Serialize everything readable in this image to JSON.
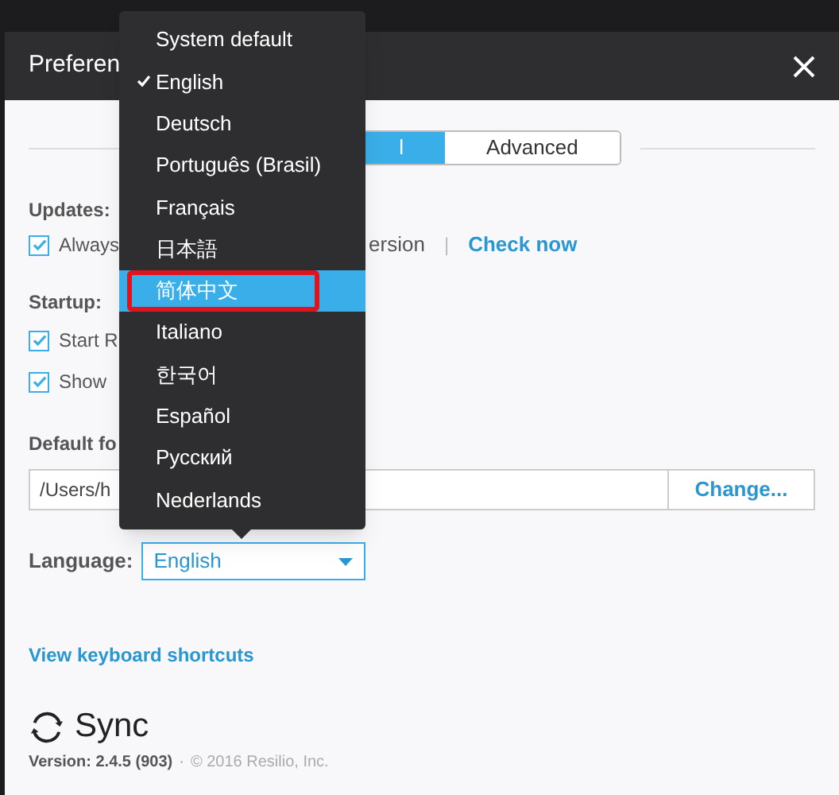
{
  "window": {
    "title": "Preferen"
  },
  "tabs": [
    {
      "label": "l",
      "selected": true
    },
    {
      "label": "Advanced",
      "selected": false
    }
  ],
  "updates": {
    "heading": "Updates:",
    "option": {
      "label": "Always",
      "checked": true
    },
    "label_end": "ersion",
    "separator": "|",
    "link": "Check now"
  },
  "startup": {
    "heading": "Startup:",
    "options": [
      {
        "label": "Start R",
        "checked": true
      },
      {
        "label": "Show",
        "checked": true
      }
    ]
  },
  "default_folder": {
    "heading": "Default fo",
    "path": "/Users/h",
    "button": "Change..."
  },
  "language": {
    "label": "Language:",
    "value": "English"
  },
  "shortcuts_link": "View keyboard shortcuts",
  "logo": "Sync",
  "footer": {
    "version": "Version: 2.4.5 (903)",
    "separator": "·",
    "copyright": "© 2016 Resilio, Inc."
  },
  "language_menu": [
    {
      "label": "System default",
      "checked": false,
      "selected": false
    },
    {
      "label": "English",
      "checked": true,
      "selected": false
    },
    {
      "label": "Deutsch",
      "checked": false,
      "selected": false
    },
    {
      "label": "Português (Brasil)",
      "checked": false,
      "selected": false
    },
    {
      "label": "Français",
      "checked": false,
      "selected": false
    },
    {
      "label": "日本語",
      "checked": false,
      "selected": false
    },
    {
      "label": "简体中文",
      "checked": false,
      "selected": true
    },
    {
      "label": "Italiano",
      "checked": false,
      "selected": false
    },
    {
      "label": "한국어",
      "checked": false,
      "selected": false
    },
    {
      "label": "Español",
      "checked": false,
      "selected": false
    },
    {
      "label": "Русский",
      "checked": false,
      "selected": false
    },
    {
      "label": "Nederlands",
      "checked": false,
      "selected": false
    }
  ]
}
